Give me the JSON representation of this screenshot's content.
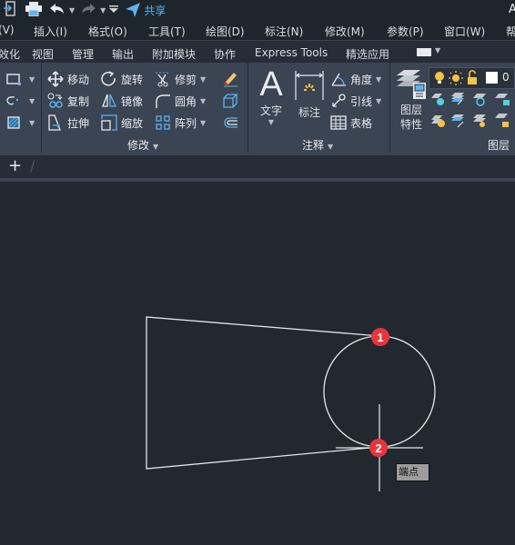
{
  "window": {
    "title_fragment": "A"
  },
  "quick_access": {
    "share_label": "共享"
  },
  "menubar": {
    "items": [
      "(V)",
      "插入(I)",
      "格式(O)",
      "工具(T)",
      "绘图(D)",
      "标注(N)",
      "修改(M)",
      "参数(P)",
      "窗口(W)",
      "帮"
    ]
  },
  "ribbon_tabs": {
    "items": [
      "效化",
      "视图",
      "管理",
      "输出",
      "附加模块",
      "协作",
      "Express Tools",
      "精选应用"
    ]
  },
  "ribbon": {
    "modify": {
      "label": "修改",
      "move": "移动",
      "rotate": "旋转",
      "trim": "修剪",
      "copy": "复制",
      "mirror": "镜像",
      "fillet": "圆角",
      "stretch": "拉伸",
      "scale": "缩放",
      "array": "阵列"
    },
    "annotation": {
      "label": "注释",
      "text": "文字",
      "dimension": "标注",
      "angle": "角度",
      "leader": "引线",
      "table": "表格"
    },
    "layers": {
      "label": "图层",
      "properties_line1": "图层",
      "properties_line2": "特性",
      "current_layer": "0",
      "colors": {
        "bulb": "#f5c242",
        "lock": "#f5c242",
        "accent_blue": "#5ab4f0",
        "cyan": "#4fd1e0"
      }
    }
  },
  "file_tabs": {
    "new_tab_label": "+",
    "separator": "/"
  },
  "canvas": {
    "markers": [
      {
        "label": "1",
        "color": "#e8353b"
      },
      {
        "label": "2",
        "color": "#e8353b"
      }
    ],
    "snap_tooltip": "端点"
  }
}
